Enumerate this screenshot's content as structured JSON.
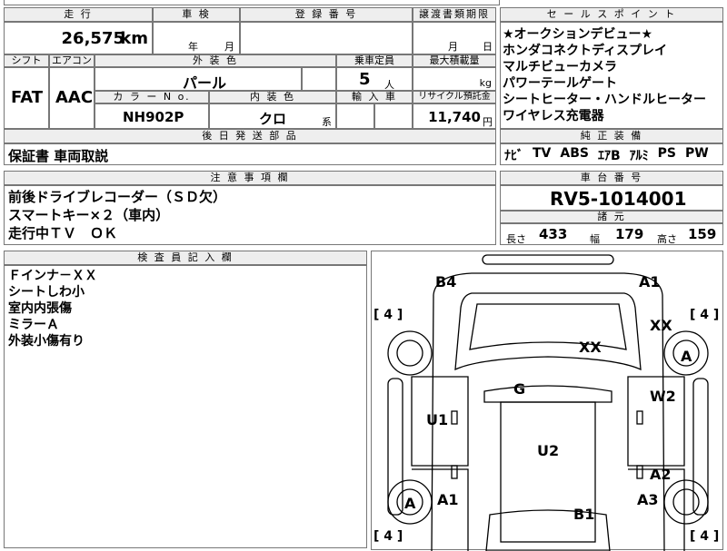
{
  "header": {
    "mileage_label": "走 行",
    "inspection_label": "車 検",
    "registration_label": "登 録 番 号",
    "transfer_label": "譲渡書類期限",
    "salespoint_label": "セ ー ル ス ポ イ ン ト",
    "mileage_value": "26,575",
    "mileage_unit": "km",
    "insp_year": "年",
    "insp_month": "月",
    "transfer_month": "月",
    "transfer_day": "日"
  },
  "specs": {
    "shift_label": "シフト",
    "ac_label": "エアコン",
    "ext_color_label": "外 装 色",
    "capacity_label": "乗車定員",
    "maxload_label": "最大積載量",
    "shift": "FAT",
    "ac": "AAC",
    "ext_color": "パール",
    "capacity": "5",
    "capacity_unit": "人",
    "maxload_unit": "kg",
    "color_no_label": "カ ラ ー N o.",
    "interior_label": "内 装 色",
    "import_label": "輸 入 車",
    "recycle_label": "リサイクル預託金",
    "color_no": "NH902P",
    "interior": "クロ",
    "interior_suffix": "系",
    "recycle": "11,740",
    "recycle_unit": "円"
  },
  "sales_points": [
    "★オークションデビュー★",
    "ホンダコネクトディスプレイ",
    "マルチビューカメラ",
    "パワーテールゲート",
    "シートヒーター・ハンドルヒーター",
    "ワイヤレス充電器"
  ],
  "later_parts": {
    "label": "後 日 発 送 部 品",
    "text": "保証書 車両取説"
  },
  "equipment": {
    "label": "純 正 装 備",
    "items": [
      "ﾅﾋﾞ",
      "TV",
      "ABS",
      "ｴｱB",
      "ｱﾙﾐ",
      "PS",
      "PW"
    ]
  },
  "notes": {
    "label": "注 意 事 項 欄",
    "lines": [
      "前後ドライブレコーダー（ＳＤ欠）",
      "スマートキー×２（車内）",
      "走行中ＴＶ　ＯＫ"
    ]
  },
  "chassis": {
    "label": "車 台 番 号",
    "value": "RV5-1014001"
  },
  "dimensions": {
    "label": "諸 元",
    "length_label": "長さ",
    "length": "433",
    "width_label": "幅",
    "width": "179",
    "height_label": "高さ",
    "height": "159"
  },
  "inspector": {
    "label": "検 査 員 記 入 欄",
    "lines": [
      "Ｆインナ－ＸＸ",
      "シートしわ小",
      "室内内張傷",
      "ミラーＡ",
      "外装小傷有り"
    ]
  },
  "diagram": {
    "tire_labels": [
      "[ 4 ]",
      "[ 4 ]",
      "[ 4 ]",
      "[ 4 ]"
    ],
    "marks": [
      "B4",
      "A1",
      "XX",
      "XX",
      "A",
      "G",
      "W2",
      "U1",
      "U2",
      "A2",
      "A",
      "A1",
      "A3",
      "B1"
    ]
  }
}
